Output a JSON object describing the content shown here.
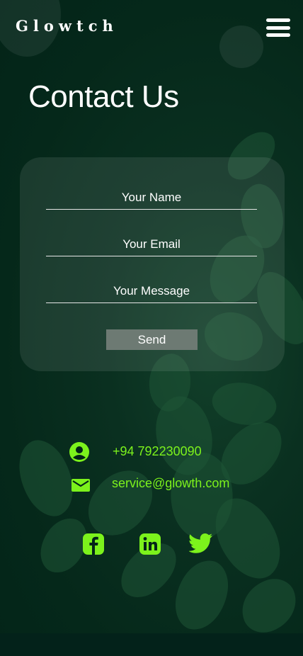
{
  "header": {
    "brand": "Glowtch",
    "menu_icon": "hamburger-menu-icon"
  },
  "page": {
    "title": "Contact Us"
  },
  "form": {
    "name_placeholder": "Your Name",
    "email_placeholder": "Your Email",
    "message_placeholder": "Your Message",
    "send_label": "Send"
  },
  "contact": {
    "phone": "+94 792230090",
    "phone_icon": "person-circle-icon",
    "email": "service@glowth.com",
    "email_icon": "envelope-icon"
  },
  "social": {
    "items": [
      {
        "name": "facebook",
        "icon": "facebook-icon"
      },
      {
        "name": "linkedin",
        "icon": "linkedin-icon"
      },
      {
        "name": "twitter",
        "icon": "twitter-icon"
      }
    ]
  },
  "colors": {
    "background": "#022418",
    "accent": "#7cf21c",
    "send_button": "#6d7a73",
    "card": "rgba(255,255,255,0.09)"
  }
}
